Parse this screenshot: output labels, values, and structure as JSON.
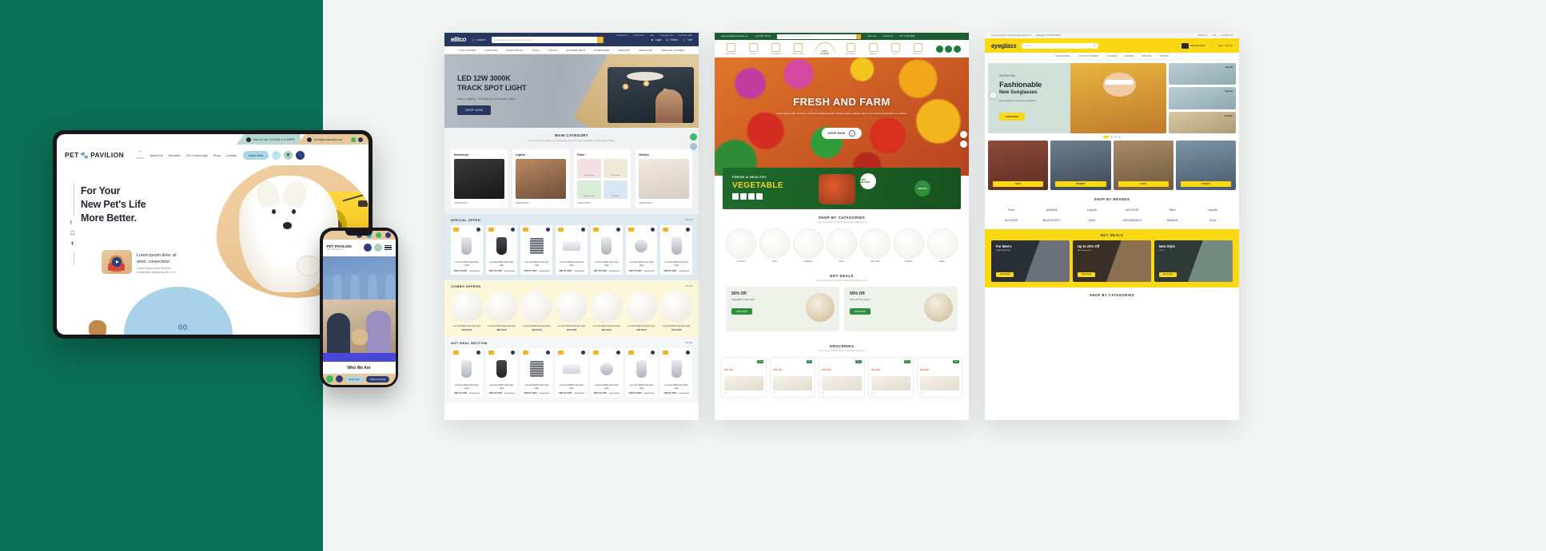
{
  "background": {
    "left_panel_color": "#0b7055",
    "page_color": "#f2f5f4"
  },
  "pet_pavilion": {
    "topbar": {
      "hours": "Mon to Sat: 9:00AM to 8:00PM",
      "email": "hello@petpavilion.ae",
      "whatsapp_icon": "whatsapp-icon",
      "phone_icon": "phone-icon"
    },
    "logo": "PET",
    "logo_mark": "paw-icon",
    "logo_second": "PAVILION",
    "menu": [
      "Home",
      "About Us",
      "Services",
      "Our Community",
      "Shop",
      "Contact"
    ],
    "book_button": "Book Now",
    "icons": [
      "heart-icon",
      "user-icon",
      "paw-icon"
    ],
    "headline_lines": [
      "For Your",
      "New Pet's Life",
      "More Better."
    ],
    "social": [
      "facebook-icon",
      "instagram-icon",
      "twitter-icon"
    ],
    "promo_title": "Lorem ipsum dolor sit amet, consectetur",
    "promo_body": "Lorem ipsum dolor sit amet, consectetur adipiscing elit. C ur",
    "play_icon": "play-icon",
    "slider_arrow": "arrow-left-icon",
    "pager": "00"
  },
  "pet_phone": {
    "logo": "PET PAVILION",
    "tagline": "Your Pet Deserves It.",
    "account": "Account",
    "section_title": "Who We Are",
    "buttons": [
      "Book Now",
      "Patient's Portal"
    ],
    "menu_icon": "hamburger-icon"
  },
  "elitco": {
    "logo": "elitco",
    "logo_sub": "cables",
    "location": "Location",
    "search_placeholder": "What can we help you find today?",
    "utility": [
      "Showrooms",
      "Track Order",
      "Help",
      "Language: EN",
      "Currency: AED"
    ],
    "actions": [
      "Login",
      "Orders",
      "Cart"
    ],
    "menu": [
      "LIGHT BULBS",
      "LIGHTING",
      "ELECTRICAL",
      "FANS",
      "TOOLS",
      "WATERPUMPS",
      "HARDWARE",
      "REPAIRS",
      "SERVICES",
      "SPECIAL OFFERS"
    ],
    "hero_title_line1": "LED 12W 3000K",
    "hero_title_line2": "TRACK SPOT LIGHT",
    "hero_sub": "Indoor Lighting - Exhibitions / Showcase Lights",
    "hero_cta": "SHOP NOW",
    "main_category_title": "MAIN CATEGORY",
    "main_category_sub": "There are many variations of passages of Lorem Ipsum available, but the majority have",
    "categories": [
      {
        "name": "Electrical",
        "cta": "SHOP NOW >"
      },
      {
        "name": "Lights",
        "cta": "SHOP NOW >"
      },
      {
        "name": "Fans",
        "cta": "SHOP NOW >",
        "sub": [
          "Ceiling Fans",
          "Other Fans",
          "Exhaust Fans",
          "Wall Fans"
        ]
      },
      {
        "name": "Others",
        "cta": "SHOP NOW >"
      }
    ],
    "special_offer": {
      "title": "SPECIAL OFFER",
      "view_all": "View All"
    },
    "combo_offers": {
      "title": "COMBO OFFERS",
      "view_all": "View All"
    },
    "hot_deal": {
      "title": "HOT DEAL SECTION",
      "view_all": "View All"
    },
    "product": {
      "name": "Led 12w 3000k Track Spot Light",
      "price": "AED 150.00",
      "old_price": "AED 200.00",
      "add_label": "ADD TO CART"
    }
  },
  "grocery": {
    "topbar": {
      "email": "sales.taste@tasteofspain.ae",
      "whatsapp": "+123 456 789 00",
      "links": [
        "About Us",
        "Contact Us"
      ],
      "phone": "971 4 546 9198"
    },
    "search_placeholder": "Strawberries, Tropicana, Mandrago cheese",
    "brand_name_line1": "TASTE",
    "brand_name_line2": "OF SPAIN",
    "categories": [
      "GROCERIES",
      "FRUITS",
      "VEGETABLES",
      "DAIRY ITEMS",
      "BUTCHERY",
      "BAKERY",
      "NUTS",
      "SEA FOOD"
    ],
    "account_icons": [
      "cart-icon",
      "wishlist-icon",
      "user-icon"
    ],
    "hero_title": "FRESH AND FARM",
    "hero_sub": "Lorem ipsum dolor sit amet, consectetur adipiscing elit. Tecitem optime, deinde etiam cum moeloroi amicoaDui vero falsore",
    "hero_cta": "SHOP NOW",
    "promo": {
      "line1": "FRESH & HEALTHY",
      "line2": "VEGETABLE",
      "badge_free": "FREE DELIVERY",
      "badge_off": "25% OFF"
    },
    "shop_by_categories": {
      "title": "SHOP BY CATAGORIES",
      "sub": "Lorem ipsum dolor sit amet, consectetur adipiscing elit"
    },
    "category_circles": [
      "Groceries",
      "Fruits",
      "Vegetables",
      "Spices",
      "Dairy Items",
      "Butchery",
      "Bakery"
    ],
    "hot_deals": {
      "title": "HOT DEALS",
      "sub": "Lorem ipsum dolor sit amet, consectetur adipiscing elit"
    },
    "deals": [
      {
        "percent": "50% Off",
        "name": "Vegetable's and fruits",
        "cta": "SHOP NOW"
      },
      {
        "percent": "50% Off",
        "name": "Nuts and Dry Items",
        "cta": "SHOP NOW"
      }
    ],
    "groceries_section": {
      "title": "GROCERIES",
      "sub": "Lorem ipsum dolor sit amet, consectetur adipiscing"
    },
    "product_offer": "Offer 50%",
    "product_badge": "New"
  },
  "eyewear": {
    "topbar": {
      "support": "Customer Support: customercare@eyeglass.com",
      "whatsapp": "Whatsapp: +971 55555 55555",
      "links": [
        "ABOUT US",
        "FAQ",
        "CONTACT US"
      ]
    },
    "logo": "eyeglass",
    "search_placeholder": "Search...",
    "header_actions": [
      "FREE DELIVERY",
      "wishlist-icon",
      "Sign In / Sign Up"
    ],
    "menu": [
      "SUNGLASSES",
      "CONTACT LENSES",
      "GLASSES",
      "FRAMES",
      "BRANDS",
      "OFFERS"
    ],
    "hero": {
      "eyebrow": "Get 50% Offer",
      "title_line1": "Fashionable",
      "title_line2": "New Sunglasses",
      "sub": "Free Shipping on all orders over $99.00",
      "cta": "SHOP NOW"
    },
    "hero_tags": [
      "#Trendy",
      "#Special",
      "#Hotsale"
    ],
    "tiles": [
      "MEN",
      "WOMEN",
      "KIDS",
      "UNISEX"
    ],
    "brands_title": "SHOP BY BRANDS",
    "brands_row1": [
      "Diva",
      "AMAZA",
      "Layola",
      "ACUVUE",
      "Nike",
      "Layola"
    ],
    "brands_row2": [
      "ACUVUE",
      "BLACKOUT",
      "Diva",
      "30SUNDAYS",
      "AMAZA",
      "Diva"
    ],
    "hot_deals_title": "HOT DEALS",
    "hot_deals": [
      {
        "title": "For Men's",
        "sub": "STARTING AT $25",
        "cta": "SHOP NOW"
      },
      {
        "title": "Up to 20% Off",
        "sub": "Black Friday Sale",
        "cta": "SHOP NOW"
      },
      {
        "title": "New Style",
        "sub": "Just In",
        "cta": "SHOP NOW"
      }
    ],
    "footer_section": "SHOP BY CATAGORIES"
  }
}
